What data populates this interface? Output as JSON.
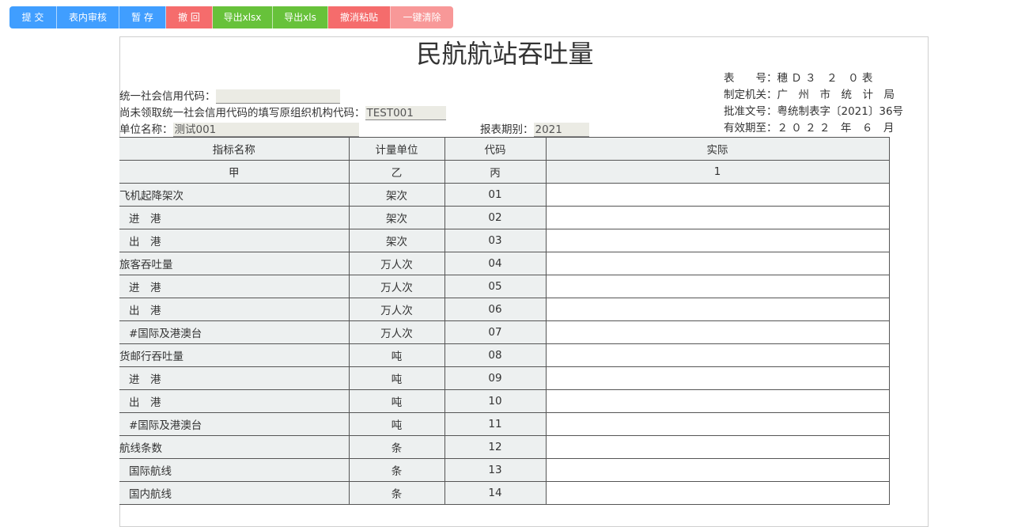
{
  "toolbar": {
    "buttons": [
      {
        "label": "提 交",
        "color": "#409eff"
      },
      {
        "label": "表内审核",
        "color": "#409eff"
      },
      {
        "label": "暂 存",
        "color": "#409eff"
      },
      {
        "label": "撤 回",
        "color": "#f56c6c"
      },
      {
        "label": "导出xlsx",
        "color": "#67c23a"
      },
      {
        "label": "导出xls",
        "color": "#67c23a"
      },
      {
        "label": "撤消粘贴",
        "color": "#f56c6c"
      },
      {
        "label": "一键清除",
        "color": "#f89898"
      }
    ]
  },
  "form": {
    "title": "民航航站吞吐量",
    "credit_code_label": "统一社会信用代码：",
    "credit_code_value": "",
    "no_credit_code_label": "尚未领取统一社会信用代码的填写原组织机构代码：",
    "no_credit_code_value": "TEST001",
    "unit_name_label": "单位名称：",
    "unit_name_value": "测试001",
    "period_label": "报表期别：",
    "period_value": "2021",
    "meta": {
      "form_no": "表　　号：穗 Ｄ ３　２　０ 表",
      "authority": "制定机关：广　州　市　统　计　局",
      "approval": "批准文号：粤统制表字〔2021〕36号",
      "valid_until": "有效期至：２ ０ ２ ２　年　６　月"
    }
  },
  "table": {
    "headers": [
      "指标名称",
      "计量单位",
      "代码",
      "实际"
    ],
    "sub_headers": [
      "甲",
      "乙",
      "丙",
      "1"
    ],
    "rows": [
      {
        "name": "飞机起降架次",
        "unit": "架次",
        "code": "01",
        "value": "",
        "indent": false
      },
      {
        "name": "进　港",
        "unit": "架次",
        "code": "02",
        "value": "",
        "indent": true
      },
      {
        "name": "出　港",
        "unit": "架次",
        "code": "03",
        "value": "",
        "indent": true
      },
      {
        "name": "旅客吞吐量",
        "unit": "万人次",
        "code": "04",
        "value": "",
        "indent": false
      },
      {
        "name": "进　港",
        "unit": "万人次",
        "code": "05",
        "value": "",
        "indent": true
      },
      {
        "name": "出　港",
        "unit": "万人次",
        "code": "06",
        "value": "",
        "indent": true
      },
      {
        "name": "#国际及港澳台",
        "unit": "万人次",
        "code": "07",
        "value": "",
        "indent": true
      },
      {
        "name": "货邮行吞吐量",
        "unit": "吨",
        "code": "08",
        "value": "",
        "indent": false
      },
      {
        "name": "进　港",
        "unit": "吨",
        "code": "09",
        "value": "",
        "indent": true
      },
      {
        "name": "出　港",
        "unit": "吨",
        "code": "10",
        "value": "",
        "indent": true
      },
      {
        "name": "#国际及港澳台",
        "unit": "吨",
        "code": "11",
        "value": "",
        "indent": true
      },
      {
        "name": "航线条数",
        "unit": "条",
        "code": "12",
        "value": "",
        "indent": false
      },
      {
        "name": "国际航线",
        "unit": "条",
        "code": "13",
        "value": "",
        "indent": true
      },
      {
        "name": "国内航线",
        "unit": "条",
        "code": "14",
        "value": "",
        "indent": true
      }
    ]
  }
}
